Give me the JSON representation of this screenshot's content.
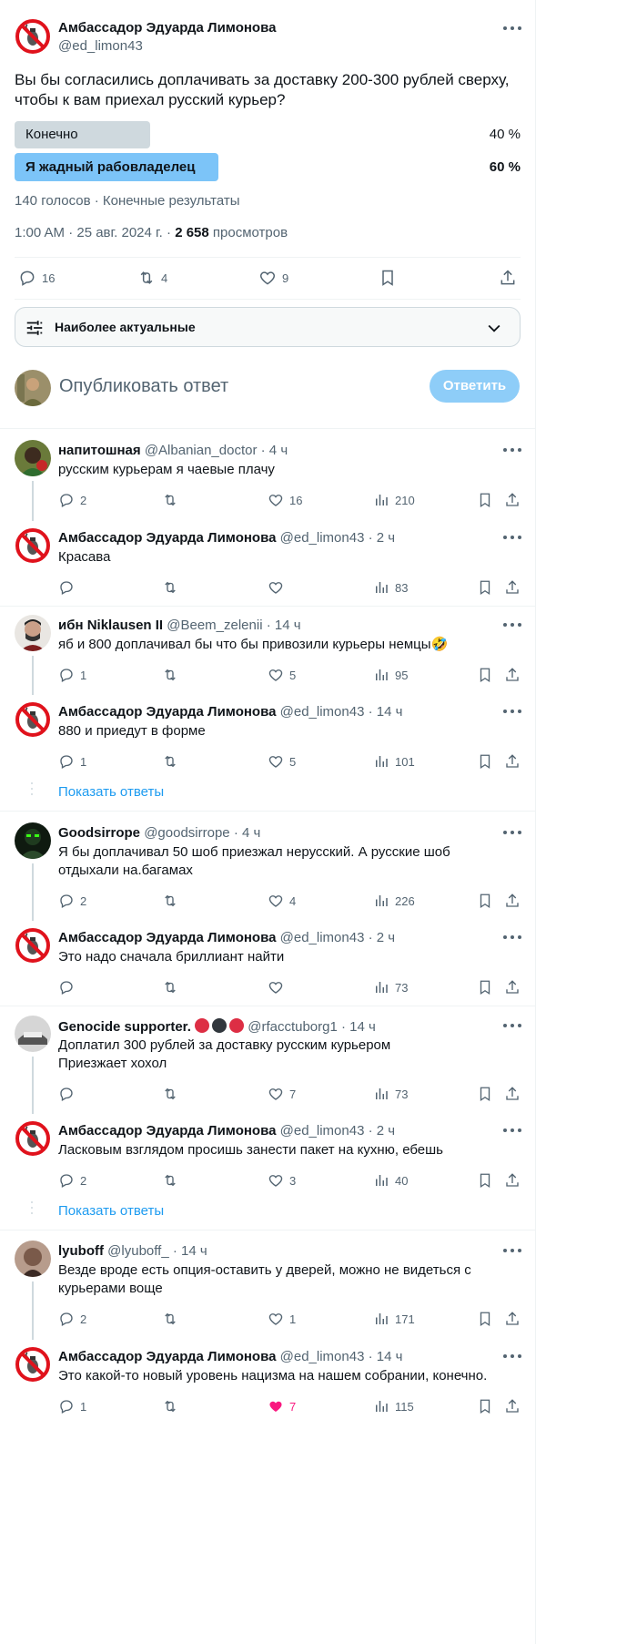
{
  "main_tweet": {
    "author_name": "Амбассадор Эдуарда Лимонова",
    "author_handle": "@ed_limon43",
    "text": "Вы бы согласились доплачивать за доставку 200-300 рублей сверху, чтобы к вам приехал русский курьер?",
    "poll": {
      "options": [
        {
          "label": "Конечно",
          "percent_label": "40 %",
          "value": 40,
          "winner": false
        },
        {
          "label": "Я жадный рабовладелец",
          "percent_label": "60 %",
          "value": 60,
          "winner": true
        }
      ],
      "summary": "140 голосов · Конечные результаты"
    },
    "time_date": "1:00 AM · 25 авг. 2024 г. · ",
    "views_count": "2 658",
    "views_label": " просмотров",
    "stats": {
      "replies": "16",
      "retweets": "4",
      "likes": "9"
    }
  },
  "sort": {
    "label": "Наиболее актуальные"
  },
  "compose": {
    "placeholder": "Опубликовать ответ",
    "button": "Ответить"
  },
  "show_replies_label": "Показать ответы",
  "replies": [
    {
      "name": "напитошная",
      "handle": "@Albanian_doctor",
      "time": "· 4 ч",
      "text": "русским курьерам я чаевые плачу",
      "replies": "2",
      "retweets": "",
      "likes": "16",
      "views": "210"
    },
    {
      "name": "Амбассадор Эдуарда Лимонова",
      "handle": "@ed_limon43",
      "time": "· 2 ч",
      "text": "Красава",
      "replies": "",
      "retweets": "",
      "likes": "",
      "views": "83"
    },
    {
      "name": "ибн Niklausen II",
      "handle": "@Beem_zelenii",
      "time": "· 14 ч",
      "text": "яб и 800 доплачивал бы что бы привозили курьеры немцы🤣",
      "replies": "1",
      "retweets": "",
      "likes": "5",
      "views": "95"
    },
    {
      "name": "Амбассадор Эдуарда Лимонова",
      "handle": "@ed_limon43",
      "time": "· 14 ч",
      "text": "880 и приедут в форме",
      "replies": "1",
      "retweets": "",
      "likes": "5",
      "views": "101"
    },
    {
      "name": "Goodsirrope",
      "handle": "@goodsirrope",
      "time": "· 4 ч",
      "text": "Я бы доплачивал 50 шоб приезжал нерусский. А русские шоб отдыхали на.багамах",
      "replies": "2",
      "retweets": "",
      "likes": "4",
      "views": "226"
    },
    {
      "name": "Амбассадор Эдуарда Лимонова",
      "handle": "@ed_limon43",
      "time": "· 2 ч",
      "text": "Это надо сначала бриллиант найти",
      "replies": "",
      "retweets": "",
      "likes": "",
      "views": "73"
    },
    {
      "name": "Genocide supporter.",
      "handle": "@rfacctuborg1",
      "time": "· 14 ч",
      "text": "Доплатил 300 рублей за доставку русским курьером\nПриезжает хохол",
      "replies": "",
      "retweets": "",
      "likes": "7",
      "views": "73"
    },
    {
      "name": "Амбассадор Эдуарда Лимонова",
      "handle": "@ed_limon43",
      "time": "· 2 ч",
      "text": "Ласковым взглядом просишь занести пакет на кухню, ебешь",
      "replies": "2",
      "retweets": "",
      "likes": "3",
      "views": "40"
    },
    {
      "name": "lyuboff",
      "handle": "@lyuboff_",
      "time": "· 14 ч",
      "text": "Везде вроде есть опция-оставить у дверей, можно не видеться с курьерами воще",
      "replies": "2",
      "retweets": "",
      "likes": "1",
      "views": "171"
    },
    {
      "name": "Амбассадор Эдуарда Лимонова",
      "handle": "@ed_limon43",
      "time": "· 14 ч",
      "text": "Это какой-то новый уровень нацизма на нашем собрании, конечно.",
      "replies": "1",
      "retweets": "",
      "likes": "7",
      "views": "115",
      "liked": true
    }
  ],
  "colors": {
    "accent": "#1d9bf0",
    "poll_winner": "#7cc4f8",
    "poll_other": "#cfd9de",
    "like_active": "#f91880",
    "muted": "#536471"
  }
}
